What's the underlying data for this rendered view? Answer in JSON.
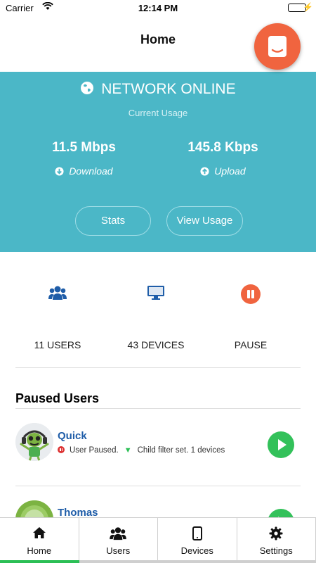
{
  "status_bar": {
    "carrier": "Carrier",
    "time": "12:14 PM"
  },
  "nav": {
    "title": "Home"
  },
  "hero": {
    "status": "NETWORK ONLINE",
    "caption": "Current Usage",
    "download": {
      "value": "11.5 Mbps",
      "label": "Download"
    },
    "upload": {
      "value": "145.8 Kbps",
      "label": "Upload"
    },
    "buttons": {
      "stats": "Stats",
      "view_usage": "View Usage"
    }
  },
  "quick_actions": {
    "users": "11 USERS",
    "devices": "43 DEVICES",
    "pause": "PAUSE"
  },
  "paused_users": {
    "title": "Paused Users",
    "items": [
      {
        "name": "Quick",
        "status": "User Paused.",
        "filter": "Child filter set. 1 devices"
      },
      {
        "name": "Thomas"
      }
    ]
  },
  "tabs": [
    {
      "label": "Home",
      "icon": "home-icon"
    },
    {
      "label": "Users",
      "icon": "users-icon"
    },
    {
      "label": "Devices",
      "icon": "tablet-icon"
    },
    {
      "label": "Settings",
      "icon": "gear-icon"
    }
  ],
  "colors": {
    "hero_bg": "#4bb7c7",
    "accent_orange": "#f0643f",
    "brand_blue": "#1f5da8",
    "active_green": "#2bbf55"
  }
}
